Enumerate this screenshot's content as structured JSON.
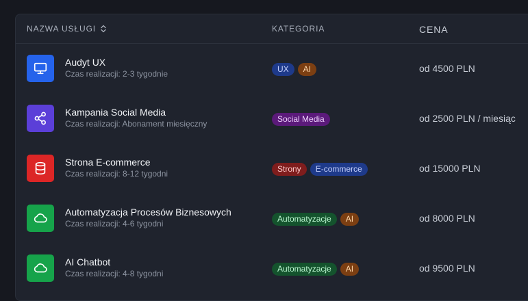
{
  "header": {
    "name_col": "NAZWA USŁUGI",
    "category_col": "KATEGORIA",
    "price_col": "CENA"
  },
  "colors": {
    "blue": "#2563eb",
    "purple": "#5b3fd8",
    "red": "#dc2626",
    "green": "#16a34a"
  },
  "rows": [
    {
      "title": "Audyt UX",
      "subtitle": "Czas realizacji: 2-3 tygodnie",
      "icon": "monitor-icon",
      "tags": [
        "UX",
        "AI"
      ],
      "price": "od 4500 PLN"
    },
    {
      "title": "Kampania Social Media",
      "subtitle": "Czas realizacji: Abonament miesięczny",
      "icon": "share-icon",
      "tags": [
        "Social Media"
      ],
      "price": "od 2500 PLN / miesiąc"
    },
    {
      "title": "Strona E-commerce",
      "subtitle": "Czas realizacji: 8-12 tygodni",
      "icon": "database-icon",
      "tags": [
        "Strony",
        "E-commerce"
      ],
      "price": "od 15000 PLN"
    },
    {
      "title": "Automatyzacja Procesów Biznesowych",
      "subtitle": "Czas realizacji: 4-6 tygodni",
      "icon": "cloud-icon",
      "tags": [
        "Automatyzacje",
        "AI"
      ],
      "price": "od 8000 PLN"
    },
    {
      "title": "AI Chatbot",
      "subtitle": "Czas realizacji: 4-8 tygodni",
      "icon": "cloud-icon",
      "tags": [
        "Automatyzacje",
        "AI"
      ],
      "price": "od 9500 PLN"
    }
  ]
}
